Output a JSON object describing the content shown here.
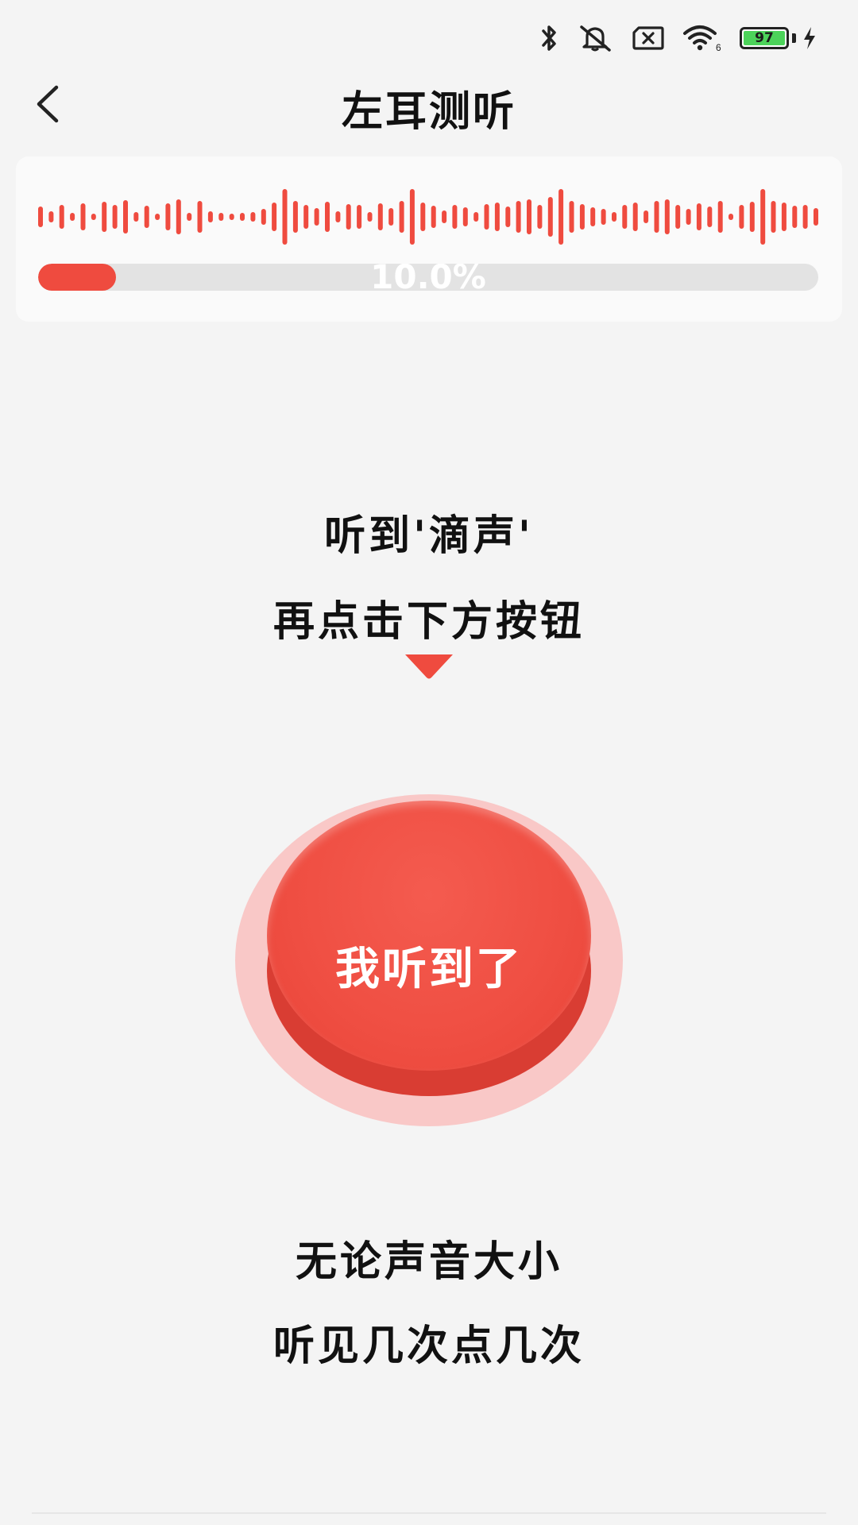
{
  "status_bar": {
    "battery_level": "97",
    "icons": [
      "bluetooth-icon",
      "mute-icon",
      "sim-off-icon",
      "wifi-icon",
      "battery-icon",
      "charging-icon"
    ],
    "wifi_badge": "6"
  },
  "header": {
    "back_icon": "chevron-left-icon",
    "title": "左耳测听"
  },
  "progress": {
    "label": "10.0%",
    "value": 0.1
  },
  "instructions": {
    "line1": "听到'滴声'",
    "line2": "再点击下方按钮"
  },
  "main_button": {
    "label": "我听到了"
  },
  "hint": {
    "line1": "无论声音大小",
    "line2": "听见几次点几次"
  },
  "colors": {
    "accent": "#ef4b3f",
    "progress_track": "#e3e3e3",
    "halo": "#f9c8c7",
    "background": "#f4f4f4"
  }
}
